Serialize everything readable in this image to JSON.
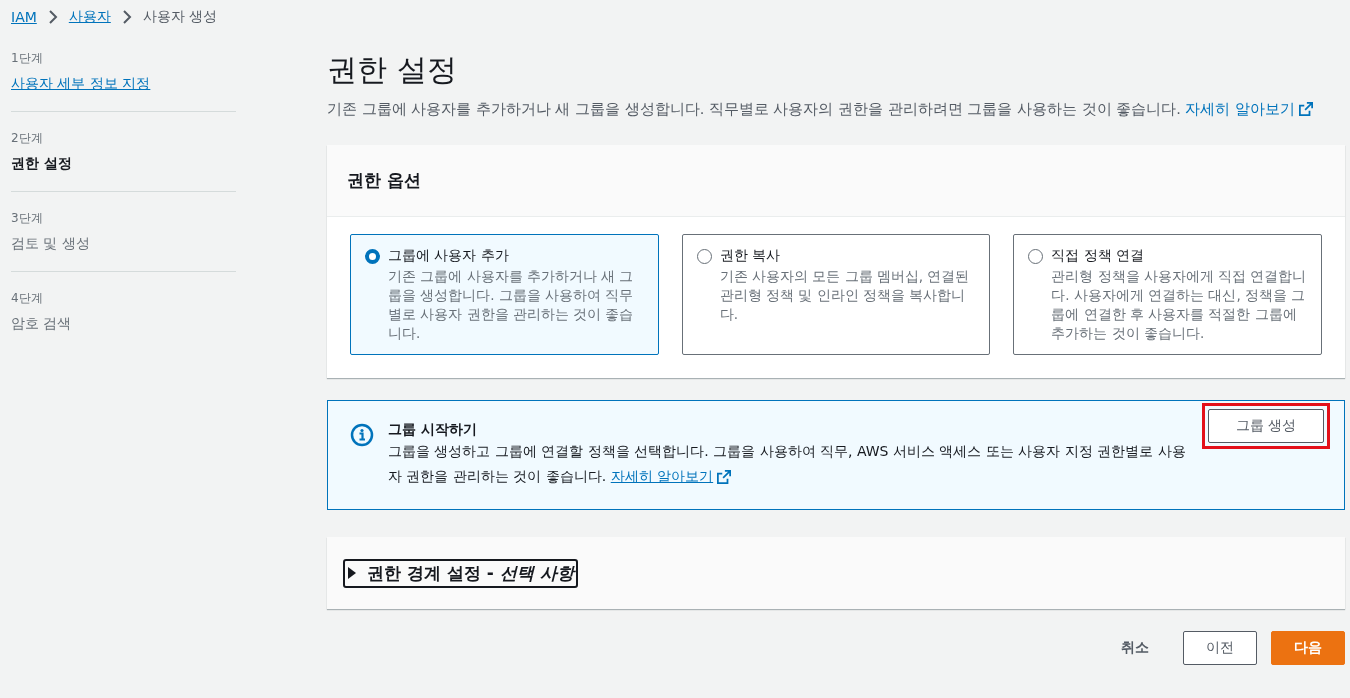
{
  "breadcrumbs": [
    {
      "label": "IAM",
      "kind": "link"
    },
    {
      "label": "사용자",
      "kind": "link"
    },
    {
      "label": "사용자 생성",
      "kind": "current"
    }
  ],
  "steps": [
    {
      "label": "1단계",
      "title": "사용자 세부 정보 지정",
      "kind": "done"
    },
    {
      "label": "2단계",
      "title": "권한 설정",
      "kind": "current"
    },
    {
      "label": "3단계",
      "title": "검토 및 생성",
      "kind": "upcoming"
    },
    {
      "label": "4단계",
      "title": "암호 검색",
      "kind": "upcoming"
    }
  ],
  "page": {
    "title": "권한 설정",
    "description": "기존 그룹에 사용자를 추가하거나 새 그룹을 생성합니다. 직무별로 사용자의 권한을 관리하려면 그룹을 사용하는 것이 좋습니다.",
    "link": "자세히 알아보기"
  },
  "permission_options": {
    "title": "권한 옵션",
    "options": [
      {
        "label": "그룹에 사용자 추가",
        "description": "기존 그룹에 사용자를 추가하거나 새 그룹을 생성합니다. 그룹을 사용하여 직무별로 사용자 권한을 관리하는 것이 좋습니다.",
        "selected": true
      },
      {
        "label": "권한 복사",
        "description": "기존 사용자의 모든 그룹 멤버십, 연결된 관리형 정책 및 인라인 정책을 복사합니다.",
        "selected": false
      },
      {
        "label": "직접 정책 연결",
        "description": "관리형 정책을 사용자에게 직접 연결합니다. 사용자에게 연결하는 대신, 정책을 그룹에 연결한 후 사용자를 적절한 그룹에 추가하는 것이 좋습니다.",
        "selected": false
      }
    ]
  },
  "info": {
    "title": "그룹 시작하기",
    "text": "그룹을 생성하고 그룹에 연결할 정책을 선택합니다. 그룹을 사용하여 직무, AWS 서비스 액세스 또는 사용자 지정 권한별로 사용자 권한을 관리하는 것이 좋습니다.",
    "link": "자세히 알아보기",
    "button": {
      "label": "그룹 생성",
      "highlighted": true
    }
  },
  "boundary": {
    "title": "권한 경계 설정 - *선택 사항*",
    "expanded": false
  },
  "footer": {
    "cancel": "취소",
    "previous": "이전",
    "next": "다음"
  }
}
